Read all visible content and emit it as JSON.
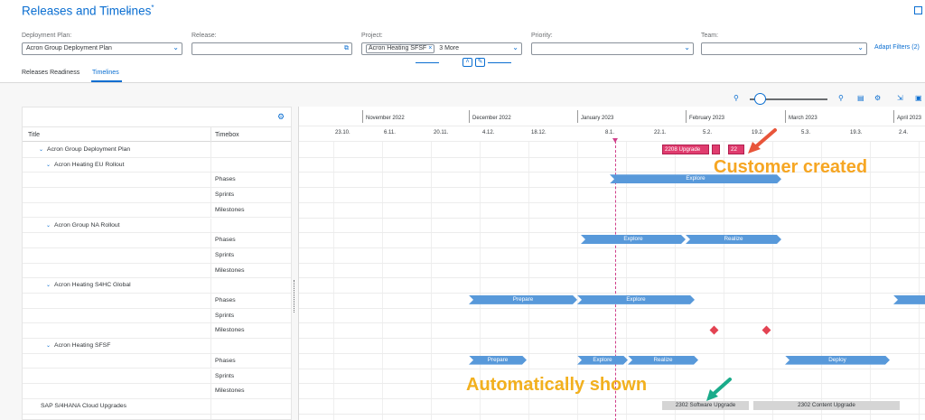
{
  "header": {
    "title": "Releases and Timelines",
    "title_mark": "*"
  },
  "filters": {
    "deployment_plan": {
      "label": "Deployment Plan:",
      "value": "Acron Group Deployment Plan"
    },
    "release": {
      "label": "Release:",
      "value": ""
    },
    "project": {
      "label": "Project:",
      "token": "Acron Heating SFSF",
      "more": "3 More"
    },
    "priority": {
      "label": "Priority:",
      "value": ""
    },
    "team": {
      "label": "Team:",
      "value": ""
    },
    "adapt_filters": "Adapt Filters (2)"
  },
  "tabs": [
    {
      "label": "Releases Readiness"
    },
    {
      "label": "Timelines"
    }
  ],
  "tree": {
    "col_title": "Title",
    "col_timebox": "Timebox",
    "rows": [
      {
        "title": "Acron Group Deployment Plan",
        "timebox": ""
      },
      {
        "title": "Acron Heating EU Rollout",
        "timebox": ""
      },
      {
        "title": "",
        "timebox": "Phases"
      },
      {
        "title": "",
        "timebox": "Sprints"
      },
      {
        "title": "",
        "timebox": "Milestones"
      },
      {
        "title": "Acron Group NA Rollout",
        "timebox": ""
      },
      {
        "title": "",
        "timebox": "Phases"
      },
      {
        "title": "",
        "timebox": "Sprints"
      },
      {
        "title": "",
        "timebox": "Milestones"
      },
      {
        "title": "Acron Heating S4HC Global",
        "timebox": ""
      },
      {
        "title": "",
        "timebox": "Phases"
      },
      {
        "title": "",
        "timebox": "Sprints"
      },
      {
        "title": "",
        "timebox": "Milestones"
      },
      {
        "title": "Acron Heating SFSF",
        "timebox": ""
      },
      {
        "title": "",
        "timebox": "Phases"
      },
      {
        "title": "",
        "timebox": "Sprints"
      },
      {
        "title": "",
        "timebox": "Milestones"
      },
      {
        "title": "SAP S/4HANA Cloud Upgrades",
        "timebox": ""
      },
      {
        "title": "",
        "timebox": ""
      }
    ]
  },
  "timeline": {
    "months": [
      "November 2022",
      "December 2022",
      "January 2023",
      "February 2023",
      "March 2023",
      "April 2023"
    ],
    "dates": [
      "23.10.",
      "6.11.",
      "20.11.",
      "4.12.",
      "18.12.",
      "8.1.",
      "22.1.",
      "5.2.",
      "19.2.",
      "5.3.",
      "19.3.",
      "2.4."
    ],
    "labels": {
      "upgrade_2208": "2208 Upgrade",
      "truncated_22": "22",
      "explore": "Explore",
      "realize": "Realize",
      "prepare": "Prepare",
      "deploy": "Deploy",
      "upgrade_2302_sw": "2302 Software Upgrade",
      "upgrade_2302_content": "2302 Content Upgrade"
    }
  },
  "annotations": {
    "customer": "Customer created",
    "automatic": "Automatically shown"
  },
  "colors": {
    "accent": "#0a6ed1",
    "phase": "#5899da",
    "customer": "#e03c6e",
    "milestone": "#e34352",
    "today": "#d0408a",
    "arrow_red": "#e8553a",
    "arrow_green": "#1aab8a"
  }
}
